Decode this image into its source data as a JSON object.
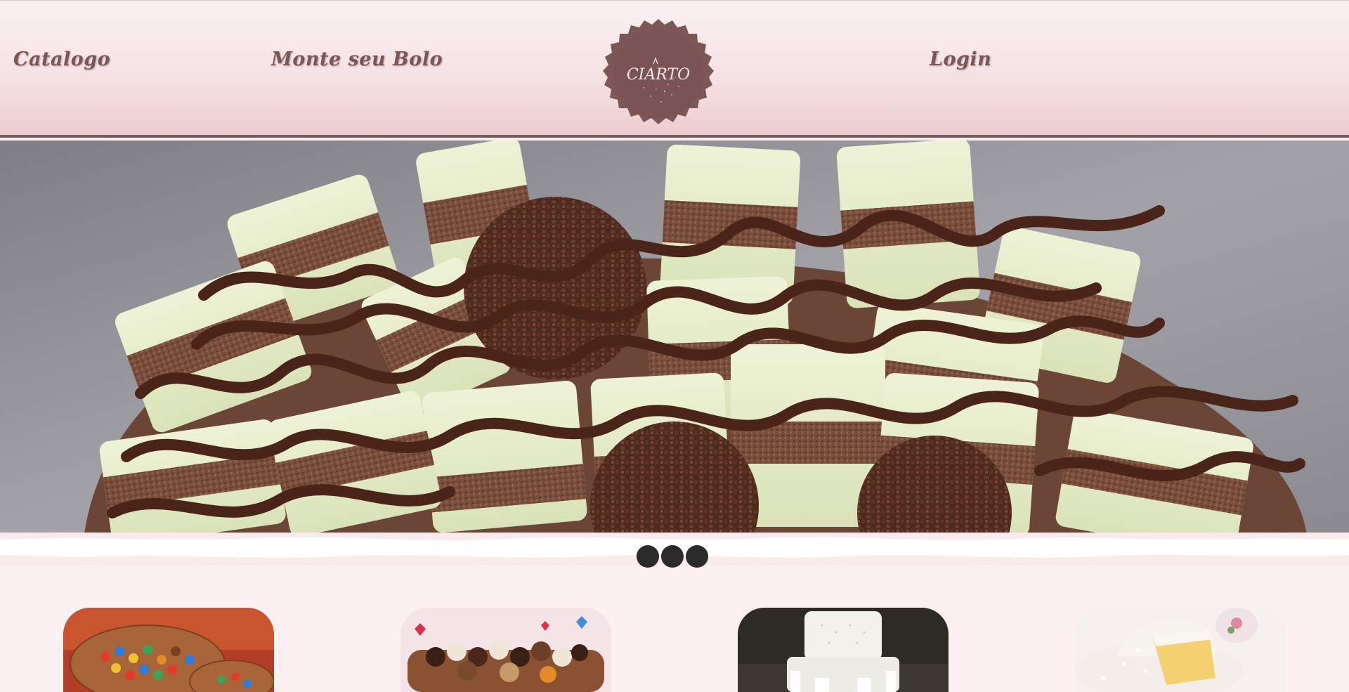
{
  "nav": {
    "catalog_label": "Catalogo",
    "build_label": "Monte seu Bolo",
    "login_label": "Login"
  },
  "logo": {
    "text": "CIARTO"
  },
  "colors": {
    "brand": "#7b5858",
    "header_bg": "#f6e2e4",
    "page_bg": "#fcf0f1",
    "dot": "#2b2b2b"
  },
  "carousel": {
    "slide_count": 3
  },
  "products": [
    {
      "name": "kitkat-mms-cake"
    },
    {
      "name": "chocolate-truffle-cake"
    },
    {
      "name": "white-fondant-cake"
    },
    {
      "name": "sponge-cake"
    }
  ]
}
